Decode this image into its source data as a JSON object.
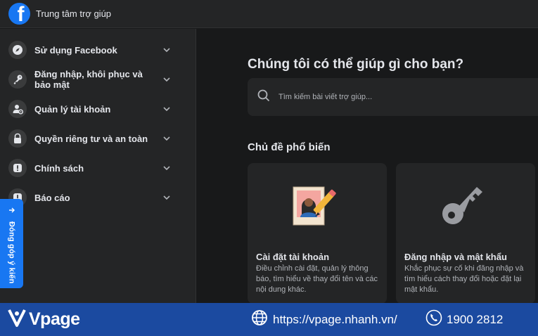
{
  "header": {
    "title": "Trung tâm trợ giúp",
    "logo": "facebook-logo"
  },
  "sidebar": {
    "items": [
      {
        "label": "Sử dụng Facebook",
        "icon": "compass-icon"
      },
      {
        "label": "Đăng nhập, khôi phục và bảo mật",
        "icon": "key-icon"
      },
      {
        "label": "Quản lý tài khoản",
        "icon": "user-settings-icon"
      },
      {
        "label": "Quyền riêng tư và an toàn",
        "icon": "lock-icon"
      },
      {
        "label": "Chính sách",
        "icon": "alert-icon"
      },
      {
        "label": "Báo cáo",
        "icon": "alert-icon"
      }
    ]
  },
  "feedback": {
    "label": "Đóng góp ý kiến",
    "icon": "arrow-right-icon"
  },
  "main": {
    "headline": "Chúng tôi có thể giúp gì cho bạn?",
    "search": {
      "placeholder": "Tìm kiếm bài viết trợ giúp..."
    },
    "popular_title": "Chủ đề phổ biến",
    "cards": [
      {
        "title": "Cài đặt tài khoản",
        "description": "Điều chỉnh cài đặt, quản lý thông báo, tìm hiểu về thay đổi tên và các nội dung khác."
      },
      {
        "title": "Đăng nhập và mật khẩu",
        "description": "Khắc phục sự cố khi đăng nhập và tìm hiểu cách thay đổi hoặc đặt lại mật khẩu."
      }
    ]
  },
  "brandbar": {
    "brand": "Vpage",
    "website": "https://vpage.nhanh.vn/",
    "phone": "1900 2812"
  },
  "colors": {
    "accent": "#1877f2",
    "background": "#18191a",
    "surface": "#242526",
    "brandbar": "#1b4aa0"
  }
}
